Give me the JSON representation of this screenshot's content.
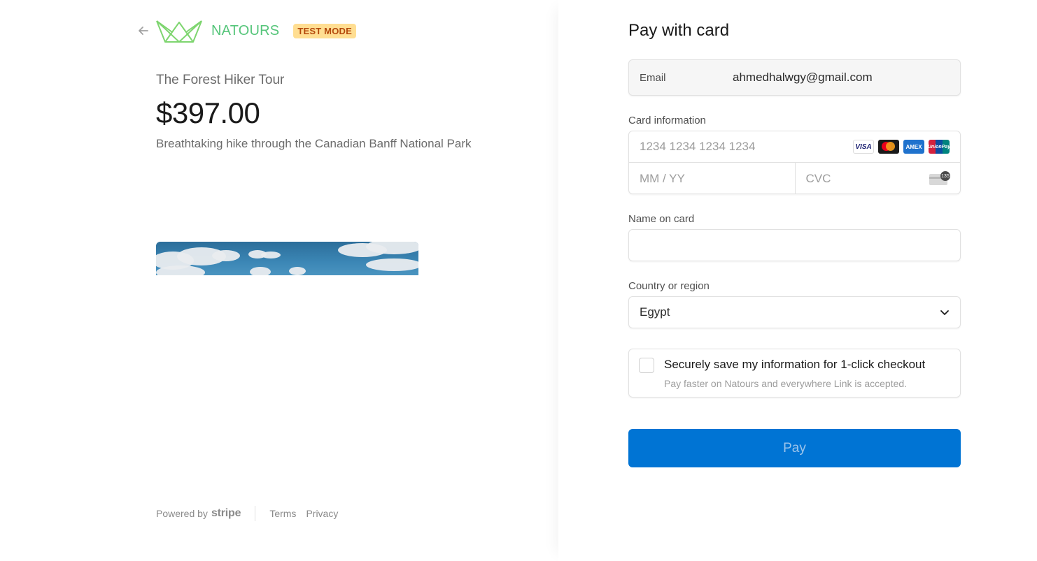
{
  "header": {
    "back_icon": "arrow-left-icon",
    "brand_name": "NATOURS",
    "mode_badge": "TEST MODE"
  },
  "product": {
    "name": "The Forest Hiker Tour",
    "price": "$397.00",
    "description": "Breathtaking hike through the Canadian Banff National Park"
  },
  "footer": {
    "powered_by": "Powered by",
    "stripe": "stripe",
    "terms": "Terms",
    "privacy": "Privacy"
  },
  "checkout": {
    "title": "Pay with card",
    "email_label": "Email",
    "email_value": "ahmedhalwgy@gmail.com",
    "card_label": "Card information",
    "card_number_placeholder": "1234 1234 1234 1234",
    "expiry_placeholder": "MM / YY",
    "cvc_placeholder": "CVC",
    "cvc_badge": "135",
    "card_brands": [
      "VISA",
      "AMEX",
      "UnionPay"
    ],
    "name_label": "Name on card",
    "name_value": "",
    "country_label": "Country or region",
    "country_value": "Egypt",
    "save_title": "Securely save my information for 1-click checkout",
    "save_subtitle": "Pay faster on Natours and everywhere Link is accepted.",
    "save_checked": false,
    "pay_label": "Pay"
  },
  "colors": {
    "brand_green": "#55c57a",
    "badge_bg": "#ffde92",
    "badge_text": "#b4480b",
    "pay_button": "#0074d4"
  }
}
